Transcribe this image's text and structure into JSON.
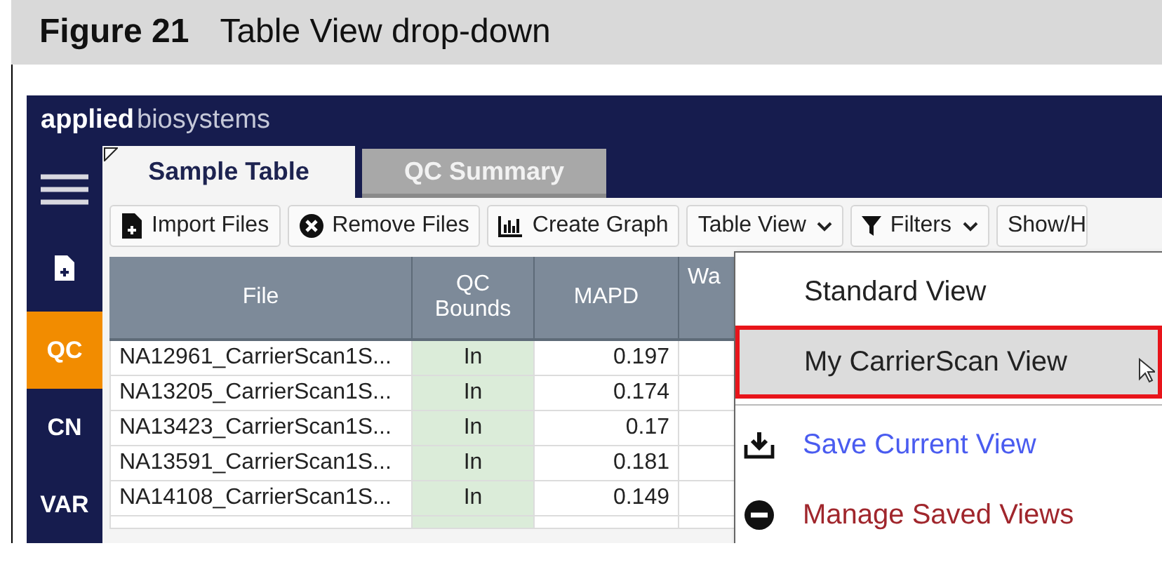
{
  "figure": {
    "number": "Figure 21",
    "caption": "Table View drop-down"
  },
  "app": {
    "logo": {
      "bold": "applied",
      "light": "biosystems"
    },
    "sidebar": {
      "items": [
        {
          "kind": "menu"
        },
        {
          "kind": "import"
        },
        {
          "kind": "label",
          "label": "QC",
          "selected": true
        },
        {
          "kind": "label",
          "label": "CN",
          "selected": false
        },
        {
          "kind": "label",
          "label": "VAR",
          "selected": false
        }
      ]
    },
    "tabs": [
      {
        "label": "Sample Table",
        "selected": true
      },
      {
        "label": "QC Summary",
        "selected": false
      }
    ],
    "toolbar": [
      {
        "kind": "import",
        "label": "Import Files"
      },
      {
        "kind": "remove",
        "label": "Remove Files"
      },
      {
        "kind": "graph",
        "label": "Create Graph"
      },
      {
        "kind": "dropdown",
        "label": "Table View"
      },
      {
        "kind": "filter",
        "label": "Filters"
      },
      {
        "kind": "plain",
        "label": "Show/H"
      }
    ],
    "table": {
      "columns": [
        {
          "label": "File"
        },
        {
          "label": "QC Bounds"
        },
        {
          "label": "MAPD"
        },
        {
          "label": "Wa"
        }
      ],
      "rows": [
        {
          "file": "NA12961_CarrierScan1S...",
          "qc_bounds": "In",
          "mapd": "0.197"
        },
        {
          "file": "NA13205_CarrierScan1S...",
          "qc_bounds": "In",
          "mapd": "0.174"
        },
        {
          "file": "NA13423_CarrierScan1S...",
          "qc_bounds": "In",
          "mapd": "0.17"
        },
        {
          "file": "NA13591_CarrierScan1S...",
          "qc_bounds": "In",
          "mapd": "0.181"
        },
        {
          "file": "NA14108_CarrierScan1S...",
          "qc_bounds": "In",
          "mapd": "0.149"
        }
      ]
    },
    "table_view_menu": {
      "items": [
        {
          "kind": "view",
          "label": "Standard View",
          "highlighted": false
        },
        {
          "kind": "view",
          "label": "My CarrierScan View",
          "highlighted": true
        },
        {
          "kind": "save",
          "label": "Save Current View",
          "color": "#4a5cf0"
        },
        {
          "kind": "manage",
          "label": "Manage Saved Views",
          "color": "#a0262c"
        }
      ]
    }
  }
}
